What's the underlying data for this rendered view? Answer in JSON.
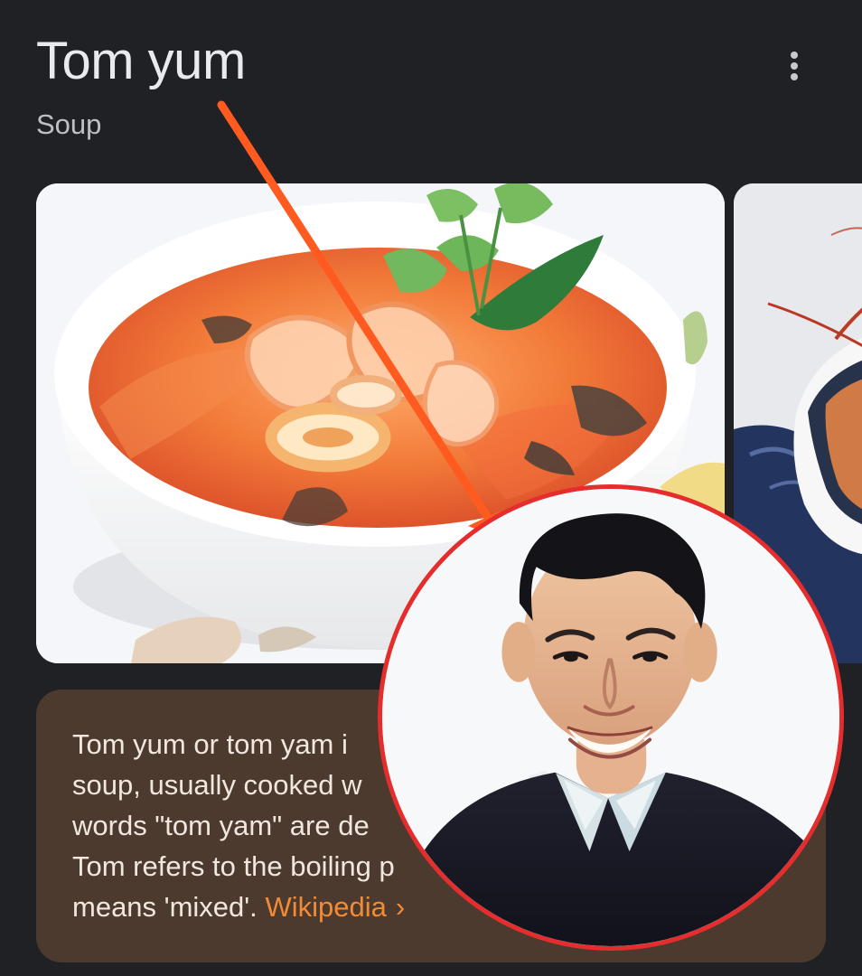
{
  "header": {
    "title": "Tom yum",
    "subtitle": "Soup",
    "more_icon": "more-vert-icon"
  },
  "images": [
    {
      "subject": "bowl of tom yum soup with shrimp, squid and herbs"
    },
    {
      "subject": "bowl of tom yum soup with shrimp on blue cloth"
    }
  ],
  "description": {
    "text_lines": [
      "Tom yum or tom yam i",
      "soup, usually cooked w",
      "words \"tom yam\" are de",
      "Tom refers to the boiling p",
      "means 'mixed'."
    ],
    "source_label": "Wikipedia",
    "source_chevron": "›"
  },
  "overlay": {
    "portrait": "smiling man in dark sweater over collared shirt",
    "annotation_arrow": "orange arrow from title to portrait",
    "colors": {
      "arrow": "#ff5a1f",
      "circle_border": "#e52d2d",
      "link_accent": "#f28b36",
      "card_background": "#4b3a2d",
      "page_background": "#202124"
    }
  }
}
